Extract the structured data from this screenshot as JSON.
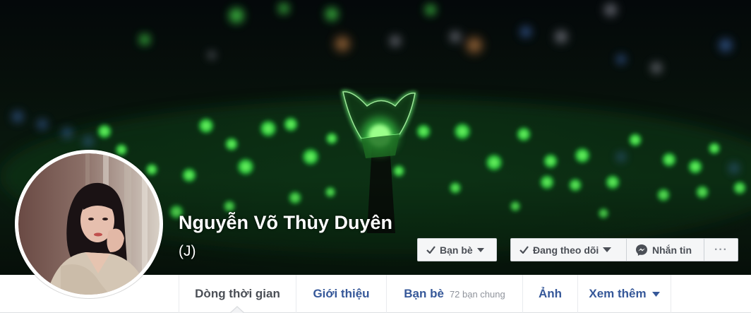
{
  "profile": {
    "name": "Nguyễn Võ Thùy Duyên",
    "alternate_name": "(J)"
  },
  "cover": {
    "description_icon": "lightstick-photo"
  },
  "avatar": {
    "icon": "profile-photo"
  },
  "actions": {
    "friends_label": "Bạn bè",
    "following_label": "Đang theo dõi",
    "message_label": "Nhắn tin",
    "more_label": "···"
  },
  "nav": {
    "timeline": "Dòng thời gian",
    "about": "Giới thiệu",
    "friends": "Bạn bè",
    "mutual_friends": "72 bạn chung",
    "photos": "Ảnh",
    "more": "Xem thêm"
  },
  "colors": {
    "link_blue": "#365899",
    "text_gray": "#4b4f56",
    "sub_gray": "#90949c",
    "button_bg": "#f5f6f7",
    "glow_green": "#3be04a",
    "messenger_icon": "#4b4f56"
  }
}
